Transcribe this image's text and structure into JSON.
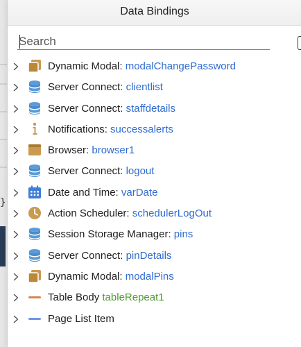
{
  "panel": {
    "title": "Data Bindings",
    "search_placeholder": "Search"
  },
  "background": {
    "brace_text": "}"
  },
  "colors": {
    "link_blue": "#2f6bd0",
    "link_green": "#4f9a2e",
    "icon_gold": "#c99a4f",
    "icon_db": "#5a9bd8",
    "icon_calendar": "#3f7fd6"
  },
  "items": [
    {
      "type": "Dynamic Modal:",
      "name": "modalChangePassword",
      "icon": "modal-icon",
      "name_color": "blue"
    },
    {
      "type": "Server Connect:",
      "name": "clientlist",
      "icon": "database-icon",
      "name_color": "blue"
    },
    {
      "type": "Server Connect:",
      "name": "staffdetails",
      "icon": "database-icon",
      "name_color": "blue"
    },
    {
      "type": "Notifications:",
      "name": "successalerts",
      "icon": "info-icon",
      "name_color": "blue"
    },
    {
      "type": "Browser:",
      "name": "browser1",
      "icon": "browser-icon",
      "name_color": "blue"
    },
    {
      "type": "Server Connect:",
      "name": "logout",
      "icon": "database-icon",
      "name_color": "blue"
    },
    {
      "type": "Date and Time:",
      "name": "varDate",
      "icon": "calendar-icon",
      "name_color": "blue"
    },
    {
      "type": "Action Scheduler:",
      "name": "schedulerLogOut",
      "icon": "clock-icon",
      "name_color": "blue"
    },
    {
      "type": "Session Storage Manager:",
      "name": "pins",
      "icon": "database-icon",
      "name_color": "blue"
    },
    {
      "type": "Server Connect:",
      "name": "pinDetails",
      "icon": "database-icon",
      "name_color": "blue"
    },
    {
      "type": "Dynamic Modal:",
      "name": "modalPins",
      "icon": "modal-icon",
      "name_color": "blue"
    },
    {
      "type": "Table Body",
      "name": "tableRepeat1",
      "icon": "orange-bar-icon",
      "name_color": "green"
    },
    {
      "type": "Page List Item",
      "name": "",
      "icon": "blue-bar-icon",
      "name_color": "blue"
    }
  ]
}
